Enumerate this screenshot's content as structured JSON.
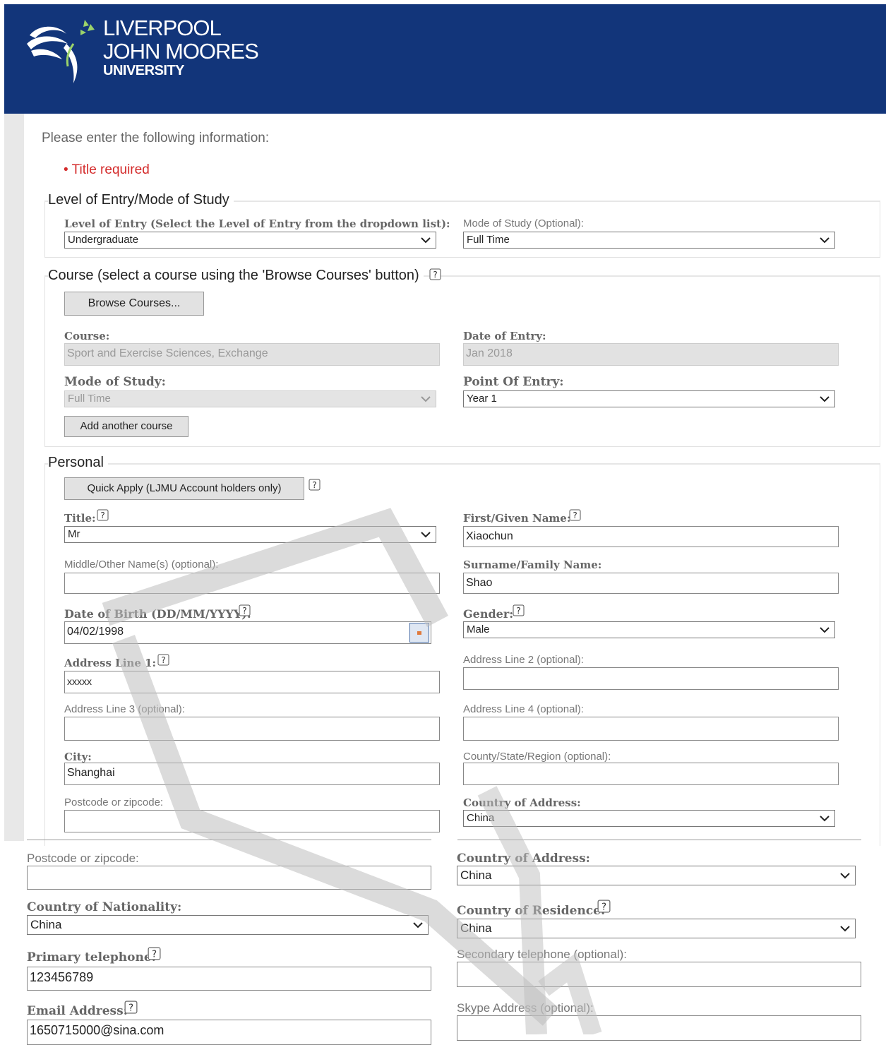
{
  "header": {
    "logo_line1": "LIVERPOOL",
    "logo_line2": "JOHN MOORES",
    "logo_line3": "UNIVERSITY",
    "bg_color": "#12357a"
  },
  "intro": "Please enter the following information:",
  "errors": [
    "Title required"
  ],
  "level_section": {
    "legend": "Level of Entry/Mode of Study",
    "level_label": "Level of Entry (Select the Level of Entry from the dropdown list):",
    "level_value": "Undergraduate",
    "mode_label": "Mode of Study (Optional):",
    "mode_value": "Full Time"
  },
  "course_section": {
    "legend": "Course (select a course using the 'Browse Courses' button)",
    "browse_label": "Browse Courses...",
    "course_label": "Course:",
    "course_value": "Sport and Exercise Sciences, Exchange",
    "date_label": "Date of Entry:",
    "date_value": "Jan 2018",
    "mode_label": "Mode of Study:",
    "mode_value": "Full Time",
    "point_label": "Point Of Entry:",
    "point_value": "Year 1",
    "add_label": "Add another course"
  },
  "personal": {
    "legend": "Personal",
    "quick_apply": "Quick Apply (LJMU Account holders only)",
    "title_label": "Title:",
    "title_value": "Mr",
    "first_label": "First/Given Name:",
    "first_value": "Xiaochun",
    "middle_label": "Middle/Other Name(s) (optional):",
    "middle_value": "",
    "surname_label": "Surname/Family Name:",
    "surname_value": "Shao",
    "dob_label": "Date of Birth (DD/MM/YYYY):",
    "dob_value": "04/02/1998",
    "gender_label": "Gender:",
    "gender_value": "Male",
    "addr1_label": "Address Line 1:",
    "addr1_value": "xxxxx",
    "addr2_label": "Address Line 2 (optional):",
    "addr2_value": "",
    "addr3_label": "Address Line 3 (optional):",
    "addr3_value": "",
    "addr4_label": "Address Line 4 (optional):",
    "addr4_value": "",
    "city_label": "City:",
    "city_value": "Shanghai",
    "county_label": "County/State/Region (optional):",
    "county_value": "",
    "postcode_label": "Postcode or zipcode:",
    "postcode_value": "",
    "country_addr_label": "Country of Address:",
    "country_addr_value": "China"
  },
  "lower": {
    "postcode_label": "Postcode or zipcode:",
    "postcode_value": "",
    "country_addr_label": "Country of Address:",
    "country_addr_value": "China",
    "nationality_label": "Country of Nationality:",
    "nationality_value": "China",
    "residence_label": "Country of Residence:",
    "residence_value": "China",
    "phone_label": "Primary telephone:",
    "phone_value": "123456789",
    "phone2_label": "Secondary telephone (optional):",
    "phone2_value": "",
    "email_label": "Email Address:",
    "email_value": "1650715000@sina.com",
    "skype_label": "Skype Address (optional):",
    "skype_value": ""
  }
}
